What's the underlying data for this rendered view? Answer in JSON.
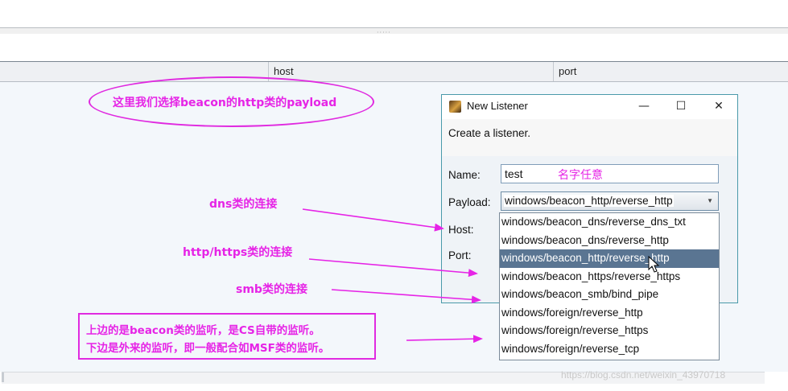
{
  "table": {
    "columns": [
      "host",
      "port"
    ]
  },
  "annotations": {
    "ellipse_text": "这里我们选择beacon的http类的payload",
    "dns_label": "dns类的连接",
    "http_label": "http/https类的连接",
    "smb_label": "smb类的连接",
    "note_line1": "上边的是beacon类的监听，是CS自带的监听。",
    "note_line2": "下边是外来的监听，即一般配合如MSF类的监听。",
    "name_hint": "名字任意",
    "color": "#e624e6"
  },
  "dialog": {
    "title": "New Listener",
    "description": "Create a listener.",
    "name_label": "Name:",
    "name_value": "test",
    "payload_label": "Payload:",
    "payload_value": "windows/beacon_http/reverse_http",
    "host_label": "Host:",
    "port_label": "Port:",
    "minimize": "—",
    "maximize": "☐",
    "close": "✕"
  },
  "payload_options": [
    "windows/beacon_dns/reverse_dns_txt",
    "windows/beacon_dns/reverse_http",
    "windows/beacon_http/reverse_http",
    "windows/beacon_https/reverse_https",
    "windows/beacon_smb/bind_pipe",
    "windows/foreign/reverse_http",
    "windows/foreign/reverse_https",
    "windows/foreign/reverse_tcp"
  ],
  "selected_option_index": 2,
  "watermark": "https://blog.csdn.net/weixin_43970718",
  "colors": {
    "selection": "#5a7592",
    "dialog_border": "#4a9aaa",
    "annotation": "#e624e6"
  }
}
